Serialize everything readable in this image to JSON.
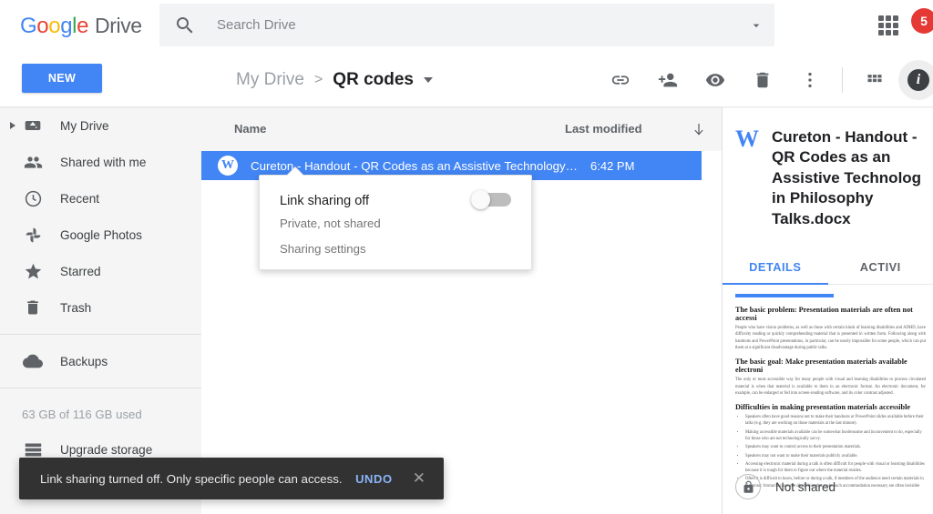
{
  "header": {
    "logo": {
      "google": "Google",
      "drive": "Drive"
    },
    "search": {
      "placeholder": "Search Drive",
      "value": "",
      "icon": "search-icon"
    },
    "search_options_icon": "chevron-down-icon",
    "apps_icon": "apps-grid-icon",
    "notification_count": "5"
  },
  "subbar": {
    "new_label": "NEW",
    "breadcrumb": {
      "parent": "My Drive",
      "separator": ">",
      "current": "QR codes"
    },
    "tools": [
      {
        "name": "get-link-icon",
        "label": "Get shareable link"
      },
      {
        "name": "add-people-icon",
        "label": "Share"
      },
      {
        "name": "preview-icon",
        "label": "Preview"
      },
      {
        "name": "trash-icon",
        "label": "Remove"
      },
      {
        "name": "more-actions-icon",
        "label": "More actions"
      },
      {
        "name": "grid-view-icon",
        "label": "Grid view"
      },
      {
        "name": "info-icon",
        "label": "i"
      }
    ]
  },
  "sidebar": {
    "items": [
      {
        "label": "My Drive",
        "icon": "drive-icon",
        "expandable": true
      },
      {
        "label": "Shared with me",
        "icon": "people-icon",
        "expandable": false
      },
      {
        "label": "Recent",
        "icon": "clock-icon",
        "expandable": false
      },
      {
        "label": "Google Photos",
        "icon": "photos-pinwheel-icon",
        "expandable": false
      },
      {
        "label": "Starred",
        "icon": "star-icon",
        "expandable": false
      },
      {
        "label": "Trash",
        "icon": "trash-icon",
        "expandable": false
      }
    ],
    "backups": {
      "label": "Backups",
      "icon": "cloud-icon"
    },
    "storage_text": "63 GB of 116 GB used",
    "upgrade": {
      "label": "Upgrade storage",
      "icon": "storage-icon"
    }
  },
  "filelist": {
    "columns": {
      "name": "Name",
      "modified": "Last modified",
      "sort_icon": "arrow-down-icon"
    },
    "rows": [
      {
        "icon": "word-file-icon",
        "icon_letter": "W",
        "name": "Cureton - Handout - QR Codes as an Assistive Technology i...",
        "modified": "6:42 PM",
        "selected": true
      }
    ]
  },
  "share_popup": {
    "title": "Link sharing off",
    "subtitle": "Private, not shared",
    "settings_link": "Sharing settings",
    "toggle_state": "off",
    "toggle_name": "link-sharing-toggle"
  },
  "details_panel": {
    "file_icon_letter": "W",
    "title": "Cureton - Handout -\nQR Codes as an\nAssistive Technolog\nin Philosophy\nTalks.docx",
    "tabs": [
      {
        "label": "DETAILS",
        "active": true
      },
      {
        "label": "ACTIVI",
        "active": false
      }
    ],
    "preview": {
      "heading1": "The basic problem: Presentation materials are often not accessi",
      "para1": "People who have vision problems, as well as those with certain kinds of learning disabilities and ADHD, have difficulty reading or quickly comprehending material that is presented in written form. Following along with handouts and PowerPoint presentations, in particular, can be nearly impossible for some people, which can put them at a significant disadvantage during public talks.",
      "heading2": "The basic goal:  Make presentation materials available electroni",
      "para2": "The only or most accessible way for many people with visual and learning disabilities to process circulated material is when that material is available to them in an electronic format. An electronic document, for example, can be enlarged or fed into screen-reading software, and its color contrast adjusted.",
      "heading3": "Difficulties in making presentation materials accessible",
      "bullets": [
        "Speakers often have good reasons not to make their handouts or PowerPoint slides available before their talks (e.g. they are working on those materials at the last minute).",
        "Making accessible materials available can be somewhat burdensome and inconvenient to do, especially for those who are not technologically savvy.",
        "Speakers may want to control access to their presentation materials.",
        "Speakers may not want to make their materials publicly available.",
        "Accessing electronic material during a talk is often difficult for people with visual or learning disabilities because it is tough for them to figure out where the material resides.",
        "Often it is difficult to know, before or during a talk, if members of the audience need certain materials in electronic format because the disabilities that make such accommodation necessary are often invisible and people who have them are often reluctant to request relevant accommodations."
      ]
    },
    "shared_status": {
      "icon": "lock-icon",
      "label": "Not shared"
    }
  },
  "toast": {
    "message": "Link sharing turned off. Only specific people can access.",
    "undo_label": "UNDO",
    "close_icon": "close-icon"
  }
}
